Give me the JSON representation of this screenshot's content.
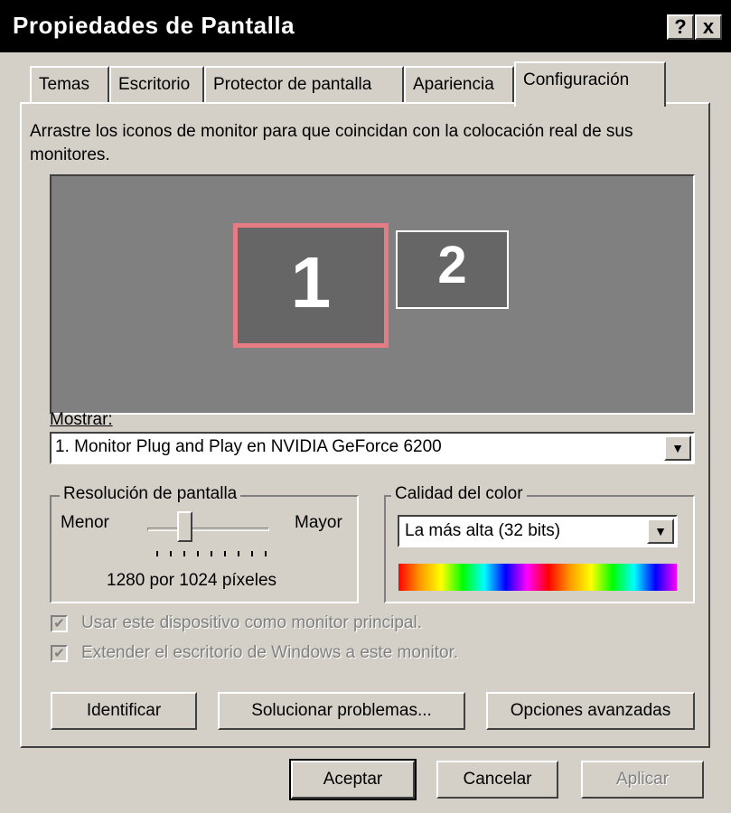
{
  "window": {
    "title": "Propiedades de Pantalla",
    "help_btn": "?",
    "close_btn": "x"
  },
  "tabs": [
    {
      "label": "Temas"
    },
    {
      "label": "Escritorio"
    },
    {
      "label": "Protector de pantalla"
    },
    {
      "label": "Apariencia"
    },
    {
      "label": "Configuración",
      "active": true
    }
  ],
  "instructions": "Arrastre los iconos de monitor para que coincidan con la colocación real de sus monitores.",
  "monitors": [
    {
      "label": "1",
      "selected": true,
      "highlight_color": "#e57c84"
    },
    {
      "label": "2",
      "selected": false
    }
  ],
  "display_label": "Mostrar:",
  "display_value": "1. Monitor Plug and Play en NVIDIA GeForce 6200",
  "resolution": {
    "group_label": "Resolución de pantalla",
    "min_label": "Menor",
    "max_label": "Mayor",
    "value_text": "1280 por 1024 píxeles"
  },
  "color_quality": {
    "group_label": "Calidad del color",
    "value": "La más alta (32 bits)"
  },
  "checkboxes": [
    {
      "label": "Usar este dispositivo como monitor principal.",
      "checked": true,
      "disabled": true
    },
    {
      "label": "Extender el escritorio de Windows a este monitor.",
      "checked": true,
      "disabled": true
    }
  ],
  "buttons": {
    "identify": "Identificar",
    "troubleshoot": "Solucionar problemas...",
    "advanced": "Opciones avanzadas",
    "ok": "Aceptar",
    "cancel": "Cancelar",
    "apply": "Aplicar"
  },
  "icons": {
    "dropdown": "chevron-down-icon",
    "check": "checkmark-icon"
  }
}
